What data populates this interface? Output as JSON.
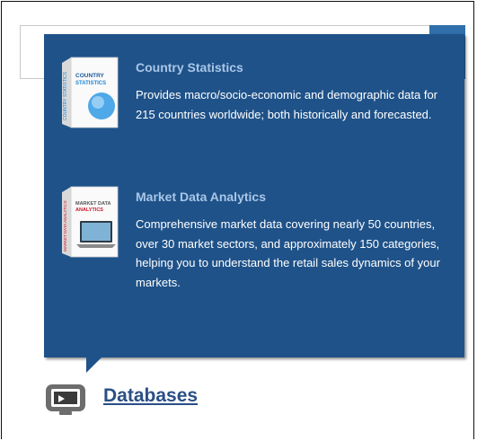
{
  "popup": {
    "items": [
      {
        "title": "Country Statistics",
        "description": "Provides macro/socio-economic and demographic data for 215 countries worldwide; both historically and forecasted.",
        "product_image": {
          "lines": [
            "COUNTRY",
            "STATISTICS"
          ],
          "spine": "COUNTRY STATISTICS",
          "accent": "#1b86d6"
        }
      },
      {
        "title": "Market Data Analytics",
        "description": "Comprehensive market data covering nearly 50 countries, over 30 market sectors, and approximately 150 categories, helping you to understand the retail sales dynamics of your markets.",
        "product_image": {
          "lines": [
            "MARKET DATA",
            "ANALYTICS"
          ],
          "spine": "MARKET DATA ANALYTICS",
          "accent": "#c8182a"
        }
      }
    ]
  },
  "databases_link": {
    "label": "Databases",
    "icon": "monitor-icon"
  },
  "colors": {
    "popup_bg": "#1f5289",
    "title": "#a9c6e8",
    "link": "#2a4f86",
    "search_button": "#2f6fab"
  }
}
